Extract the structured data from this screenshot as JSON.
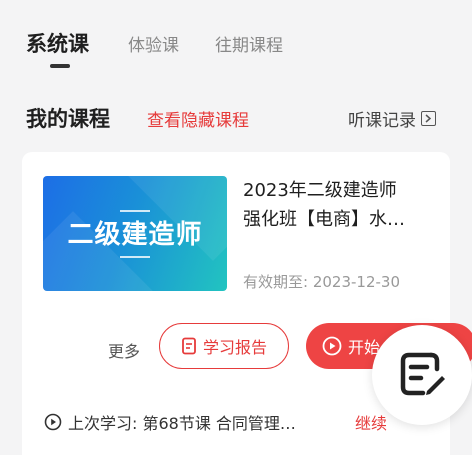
{
  "tabs": [
    {
      "label": "系统课",
      "active": true
    },
    {
      "label": "体验课",
      "active": false
    },
    {
      "label": "往期课程",
      "active": false
    }
  ],
  "section": {
    "title": "我的课程",
    "hidden_link": "查看隐藏课程",
    "history_link": "听课记录"
  },
  "course": {
    "thumbnail_title": "二级建造师",
    "title_line1": "2023年二级建造师",
    "title_line2": "强化班【电商】水…",
    "validity": "有效期至: 2023-12-30",
    "more_label": "更多",
    "report_button": "学习报告",
    "start_button": "开始",
    "last_study": "上次学习: 第68节课 合同管理…",
    "continue_label": "继续"
  },
  "colors": {
    "accent": "#e63b3b",
    "start_button_bg": "#ee4444",
    "thumbnail_gradient_start": "#1d6ee6",
    "thumbnail_gradient_end": "#22c4c0"
  },
  "icons": [
    "box-arrow-icon",
    "document-icon",
    "play-circle-icon",
    "play-circle-outline-icon",
    "note-edit-icon"
  ]
}
